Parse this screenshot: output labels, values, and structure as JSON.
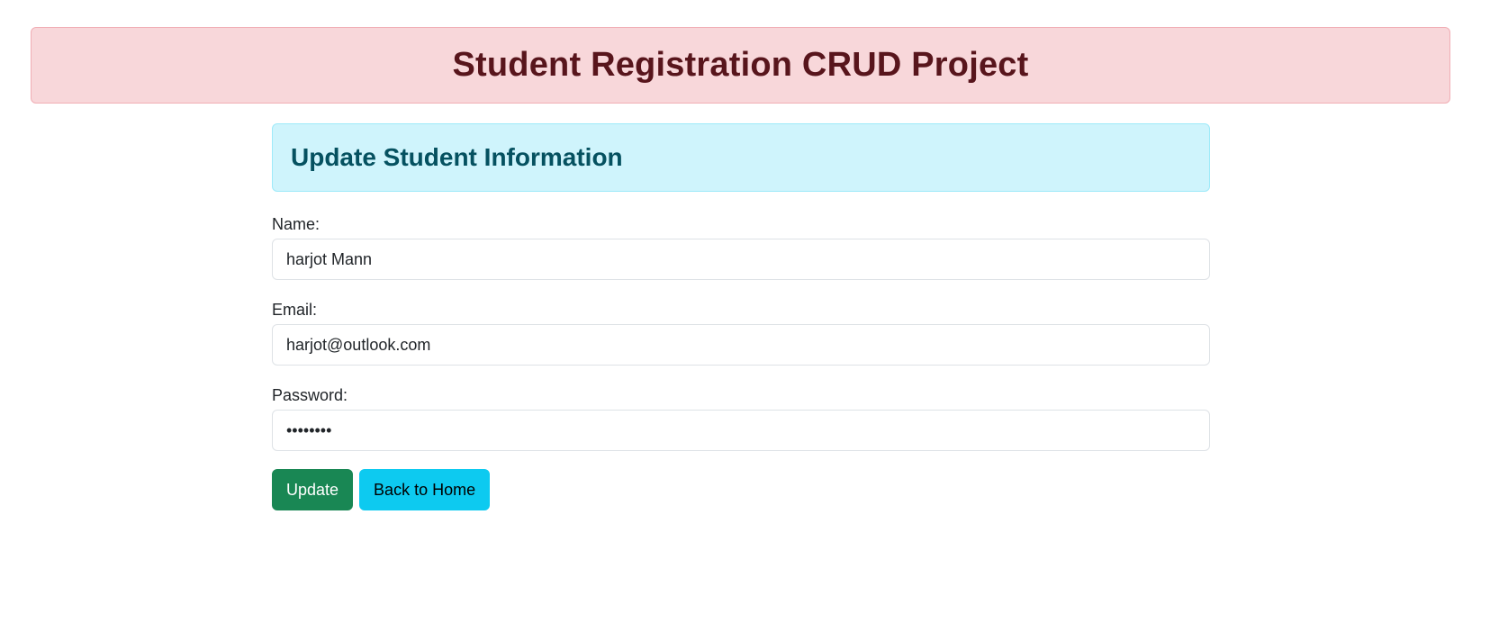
{
  "header": {
    "title": "Student Registration CRUD Project"
  },
  "form": {
    "heading": "Update Student Information",
    "name": {
      "label": "Name:",
      "value": "harjot Mann"
    },
    "email": {
      "label": "Email:",
      "value": "harjot@outlook.com"
    },
    "password": {
      "label": "Password:",
      "value": "harjot12"
    },
    "update_label": "Update",
    "back_label": "Back to Home"
  },
  "colors": {
    "banner_bg": "#f8d7da",
    "banner_text": "#58151c",
    "info_bg": "#cff4fc",
    "info_text": "#055160",
    "update_btn": "#198754",
    "back_btn": "#0dcaf0"
  }
}
